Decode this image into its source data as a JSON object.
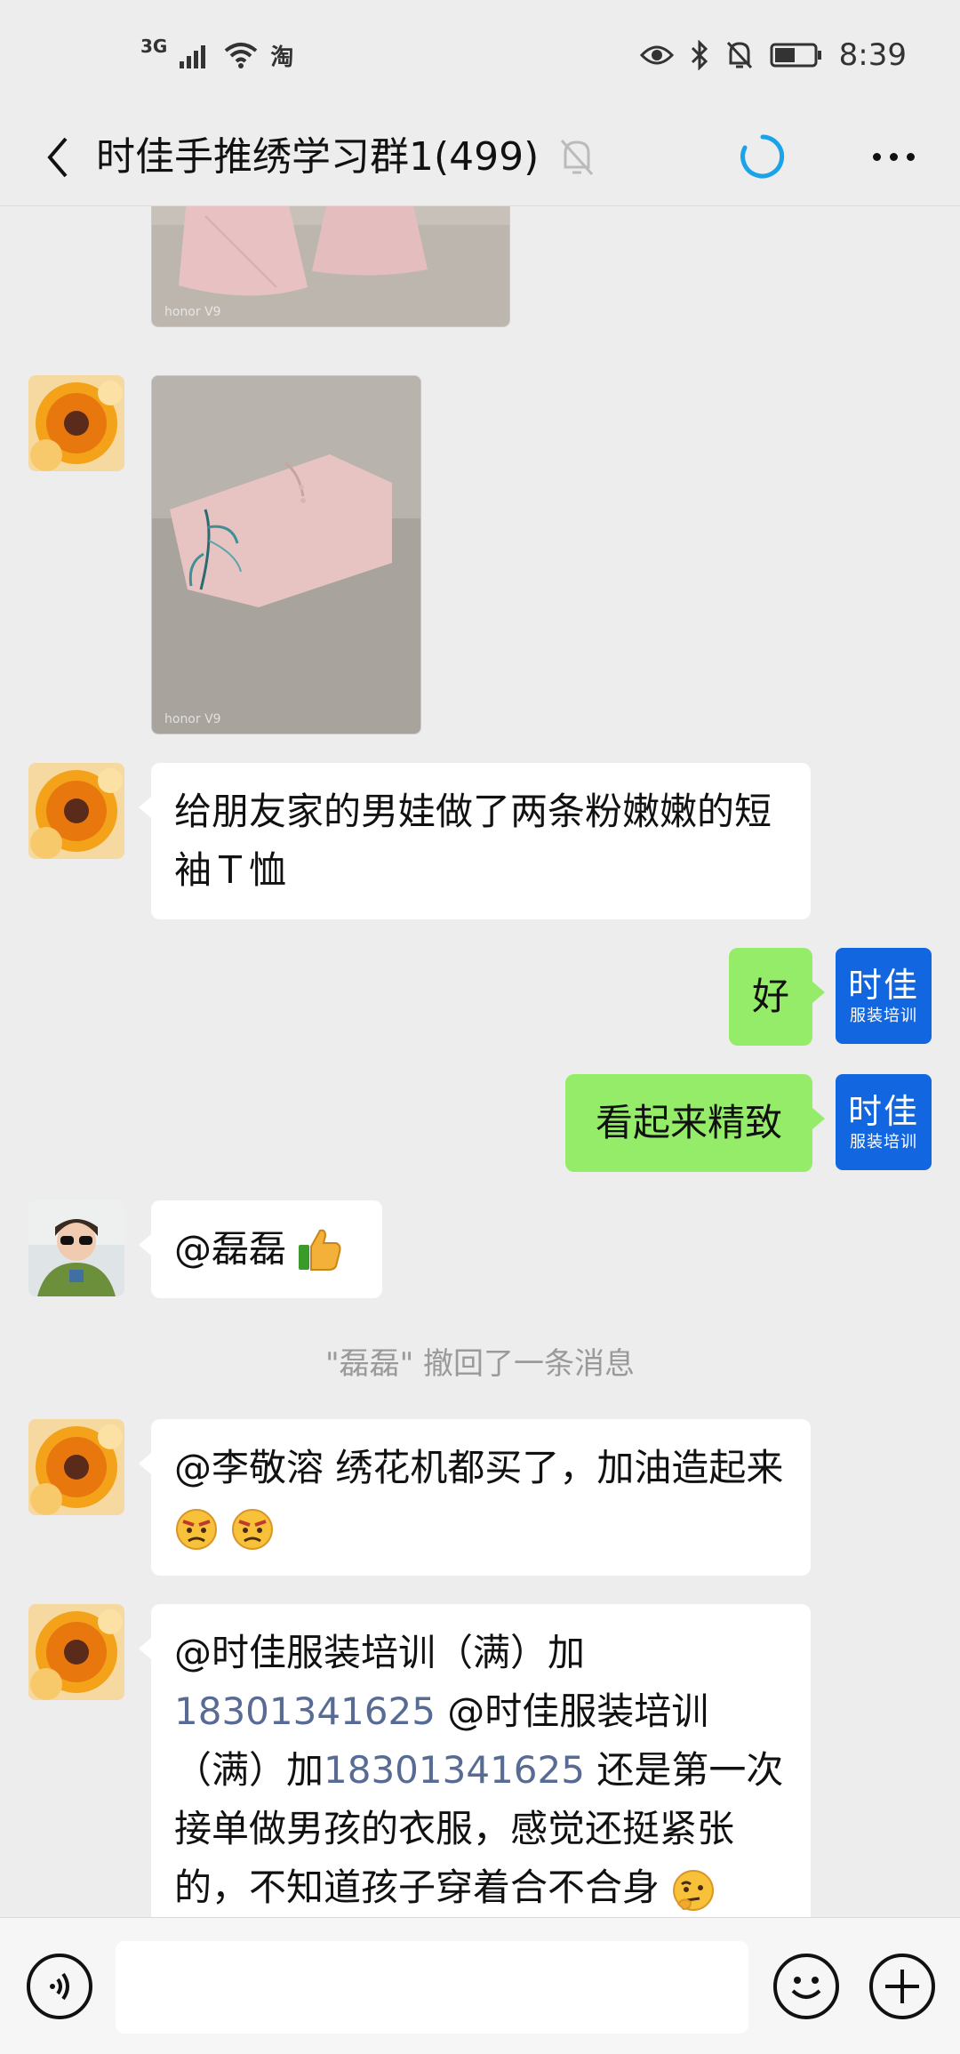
{
  "status_bar": {
    "network": "3G",
    "app_indicator": "淘",
    "time": "8:39"
  },
  "header": {
    "title": "时佳手推绣学习群1(499)"
  },
  "brand_avatar": {
    "line1": "时佳",
    "line2": "服装培训"
  },
  "messages": {
    "m1": "给朋友家的男娃做了两条粉嫩嫩的短袖Ｔ恤",
    "m2": "好",
    "m3": "看起来精致",
    "m4": "@磊磊 ",
    "system": "\"磊磊\" 撤回了一条消息",
    "m5": "@李敬溶  绣花机都买了，加油造起来",
    "m6": {
      "p1": "@时佳服装培训（满）加",
      "phone1": "18301341625",
      "p2": " @时佳服装培训（满）加",
      "phone2": "18301341625",
      "p3": " 还是第一次接单做男孩的衣服，感觉还挺紧张的，不知道孩子穿着合不合身"
    }
  },
  "photo_watermark": "honor V9",
  "colors": {
    "bubble_sent": "#95ec69",
    "bubble_received": "#ffffff",
    "link": "#576b95",
    "brand": "#1266e0",
    "background": "#ededed"
  }
}
